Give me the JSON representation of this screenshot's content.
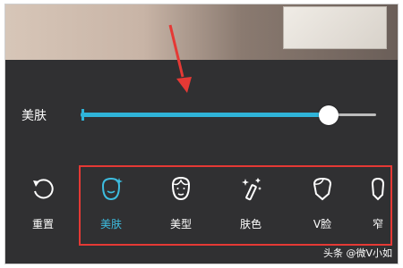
{
  "slider": {
    "label": "美肤",
    "value_fraction": 0.84
  },
  "tools": [
    {
      "id": "reset",
      "label": "重置",
      "icon": "reset-icon",
      "active": false
    },
    {
      "id": "skin",
      "label": "美肤",
      "icon": "face-sparkle-icon",
      "active": true
    },
    {
      "id": "shape",
      "label": "美型",
      "icon": "face-outline-icon",
      "active": false
    },
    {
      "id": "tone",
      "label": "肤色",
      "icon": "magic-wand-icon",
      "active": false
    },
    {
      "id": "vface",
      "label": "V脸",
      "icon": "v-face-icon",
      "active": false
    },
    {
      "id": "narrow",
      "label": "窄",
      "icon": "narrow-face-icon",
      "active": false
    }
  ],
  "watermark": "头条 @微V小如",
  "colors": {
    "accent": "#3dbde0",
    "highlight_box": "#e53935",
    "arrow": "#e53935",
    "panel": "#303032"
  }
}
